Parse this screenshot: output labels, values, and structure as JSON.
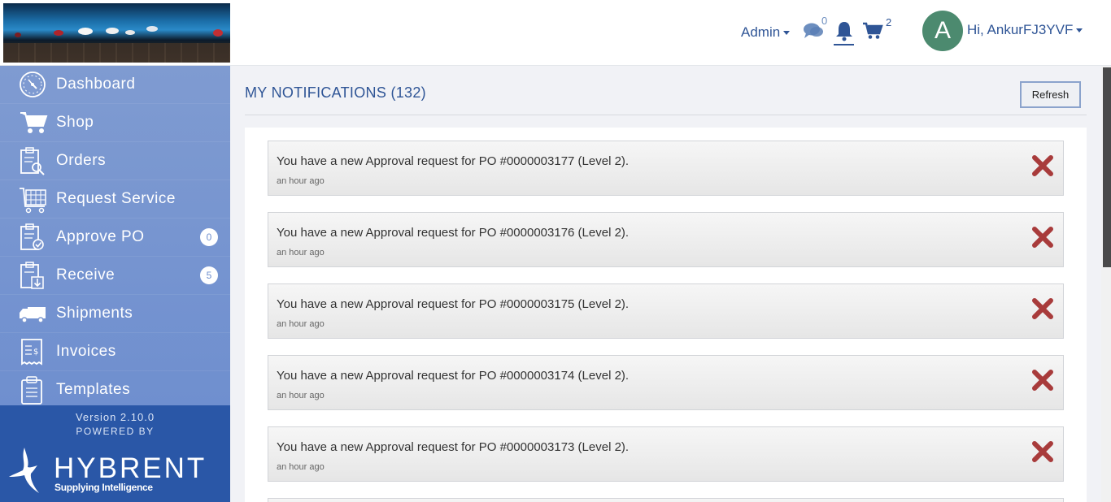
{
  "header": {
    "admin_label": "Admin",
    "chat_count": "0",
    "cart_count": "2",
    "avatar_letter": "A",
    "greeting": "Hi, AnkurFJ3YVF"
  },
  "sidebar": {
    "items": [
      {
        "label": "Dashboard",
        "icon": "dashboard-gauge-icon"
      },
      {
        "label": "Shop",
        "icon": "cart-icon"
      },
      {
        "label": "Orders",
        "icon": "clipboard-search-icon"
      },
      {
        "label": "Request Service",
        "icon": "grid-cart-icon"
      },
      {
        "label": "Approve PO",
        "icon": "clipboard-check-icon",
        "badge": "0"
      },
      {
        "label": "Receive",
        "icon": "clipboard-download-icon",
        "badge": "5"
      },
      {
        "label": "Shipments",
        "icon": "truck-icon"
      },
      {
        "label": "Invoices",
        "icon": "invoice-icon"
      },
      {
        "label": "Templates",
        "icon": "clipboard-list-icon"
      }
    ],
    "version": "Version 2.10.0",
    "powered_by": "POWERED BY",
    "brand": "HYBRENT",
    "tagline": "Supplying Intelligence"
  },
  "main": {
    "title": "MY NOTIFICATIONS (132)",
    "refresh_label": "Refresh",
    "notifications": [
      {
        "message": "You have a new Approval request for PO #0000003177 (Level 2).",
        "time": "an hour ago"
      },
      {
        "message": "You have a new Approval request for PO #0000003176 (Level 2).",
        "time": "an hour ago"
      },
      {
        "message": "You have a new Approval request for PO #0000003175 (Level 2).",
        "time": "an hour ago"
      },
      {
        "message": "You have a new Approval request for PO #0000003174 (Level 2).",
        "time": "an hour ago"
      },
      {
        "message": "You have a new Approval request for PO #0000003173 (Level 2).",
        "time": "an hour ago"
      }
    ]
  },
  "colors": {
    "accent": "#2f5596",
    "sidebar": "#7f9bd1",
    "sidebar_footer": "#2a57a7",
    "close_x": "#a83b3b",
    "avatar": "#4c8a6f"
  }
}
